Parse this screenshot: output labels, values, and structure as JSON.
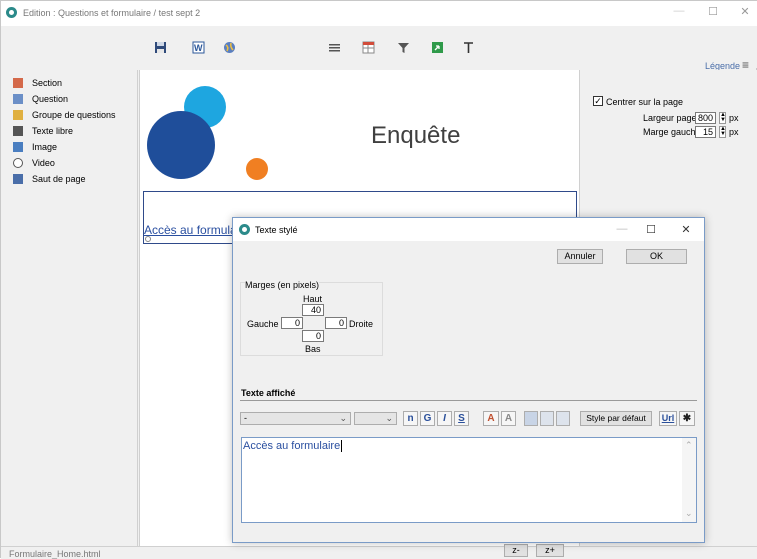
{
  "window": {
    "title": "Edition : Questions et formulaire / test sept 2",
    "minimize": "—",
    "maximize": "☐",
    "close": "✕"
  },
  "toolbar": {
    "icons": [
      "save-icon",
      "word-export-icon",
      "globe-icon",
      "align-icon",
      "table-icon",
      "filter-icon",
      "green-export-icon",
      "text-icon"
    ],
    "legend_label": "Légende",
    "menu_glyph": "≡"
  },
  "palette": {
    "items": [
      {
        "label": "Section",
        "icon": "section-icon"
      },
      {
        "label": "Question",
        "icon": "question-icon"
      },
      {
        "label": "Groupe de questions",
        "icon": "group-icon"
      },
      {
        "label": "Texte libre",
        "icon": "free-text-icon"
      },
      {
        "label": "Image",
        "icon": "image-icon"
      },
      {
        "label": "Video",
        "icon": "video-icon"
      },
      {
        "label": "Saut de page",
        "icon": "page-break-icon"
      }
    ]
  },
  "canvas": {
    "header_title": "Enquête",
    "link_text": "Accès au formulaire",
    "colors": {
      "dark_blue": "#1f4e9a",
      "light_blue": "#1ea6e0",
      "orange": "#f07f22"
    }
  },
  "right": {
    "center_label": "Centrer sur la page",
    "center_checked": true,
    "width_label": "Largeur page",
    "width_value": "800",
    "width_unit": "px",
    "margin_label": "Marge gauche",
    "margin_value": "15",
    "margin_unit": "px"
  },
  "status": {
    "filename": "Formulaire_Home.html",
    "zoom_out": "z-",
    "zoom_in": "z+"
  },
  "dialog": {
    "title": "Texte stylé",
    "minimize": "—",
    "maximize": "☐",
    "close": "✕",
    "cancel_label": "Annuler",
    "ok_label": "OK",
    "margins": {
      "group_label": "Marges (en pixels)",
      "top_label": "Haut",
      "top_value": "40",
      "left_label": "Gauche",
      "left_value": "0",
      "right_value": "0",
      "right_label": "Droite",
      "bottom_value": "0",
      "bottom_label": "Bas"
    },
    "text_section_label": "Texte affiché",
    "font_select": "-",
    "size_select": "",
    "format_buttons": [
      "n",
      "G",
      "I",
      "S"
    ],
    "style_default_label": "Style par défaut",
    "url_label": "Url",
    "editor_text": "Accès au formulaire"
  }
}
